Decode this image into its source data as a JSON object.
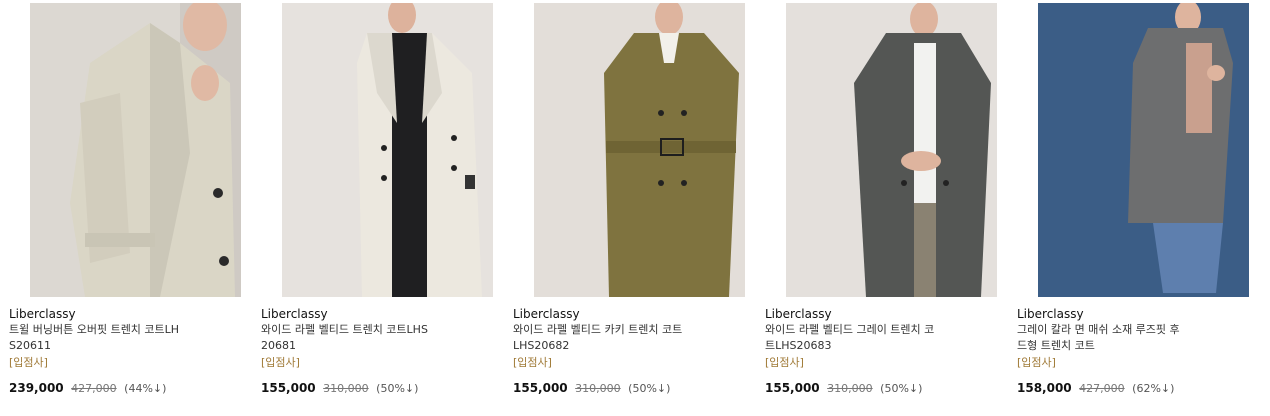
{
  "products": [
    {
      "brand": "Liberclassy",
      "name": "트윌 버닝버튼 오버핏 트렌치 코트LHS20611",
      "tag": "[입점사]",
      "sale_price": "239,000",
      "original_price": "427,000",
      "discount": "(44%↓)",
      "colors": {
        "bg": "#dcd8d2",
        "coat": "#dad6c6"
      }
    },
    {
      "brand": "Liberclassy",
      "name": "와이드 라펠 벨티드 트렌치 코트LHS20681",
      "tag": "[입점사]",
      "sale_price": "155,000",
      "original_price": "310,000",
      "discount": "(50%↓)",
      "colors": {
        "bg": "#e6e2de",
        "coat": "#ece8df"
      }
    },
    {
      "brand": "Liberclassy",
      "name": "와이드 라펠 벨티드 카키 트렌치 코트LHS20682",
      "tag": "[입점사]",
      "sale_price": "155,000",
      "original_price": "310,000",
      "discount": "(50%↓)",
      "colors": {
        "bg": "#e3ded9",
        "coat": "#7f733f"
      }
    },
    {
      "brand": "Liberclassy",
      "name": "와이드 라펠 벨티드 그레이 트렌치 코트LHS20683",
      "tag": "[입점사]",
      "sale_price": "155,000",
      "original_price": "310,000",
      "discount": "(50%↓)",
      "colors": {
        "bg": "#e4e0dc",
        "coat": "#545654"
      }
    },
    {
      "brand": "Liberclassy",
      "name": "그레이 칼라 면 매쉬 소재 루즈핏 후드형 트렌치 코트",
      "tag": "[입점사]",
      "sale_price": "158,000",
      "original_price": "427,000",
      "discount": "(62%↓)",
      "colors": {
        "bg": "#3b5d86",
        "coat": "#6d6e6f"
      }
    }
  ]
}
